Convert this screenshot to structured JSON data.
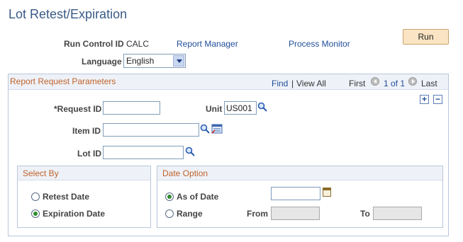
{
  "page": {
    "title": "Lot Retest/Expiration"
  },
  "run_control": {
    "label": "Run Control ID",
    "value": "CALC",
    "report_manager": "Report Manager",
    "process_monitor": "Process Monitor",
    "run_label": "Run"
  },
  "language": {
    "label": "Language",
    "selected": "English"
  },
  "params": {
    "title": "Report Request Parameters",
    "find": "Find",
    "separator": "|",
    "view_all": "View All",
    "first": "First",
    "range_text": "1 of 1",
    "last": "Last",
    "add": "+",
    "remove": "−"
  },
  "fields": {
    "request_id_label": "*Request ID",
    "request_id_value": "",
    "unit_label": "Unit",
    "unit_value": "US001",
    "item_id_label": "Item ID",
    "item_id_value": "",
    "lot_id_label": "Lot ID",
    "lot_id_value": ""
  },
  "select_by": {
    "title": "Select By",
    "options": [
      {
        "label": "Retest Date",
        "selected": false
      },
      {
        "label": "Expiration Date",
        "selected": true
      }
    ]
  },
  "date_option": {
    "title": "Date Option",
    "as_of_label": "As of Date",
    "as_of_selected": true,
    "as_of_value": "",
    "range_label": "Range",
    "range_selected": false,
    "from_label": "From",
    "from_value": "",
    "to_label": "To",
    "to_value": ""
  },
  "colors": {
    "accent": "#c0622a",
    "link": "#1f4d99",
    "title": "#3a5a86",
    "run_button": "#fbe4c3"
  },
  "icons": [
    "search-icon",
    "multi-lookup-icon",
    "calendar-icon",
    "nav-prev-icon",
    "nav-next-icon"
  ]
}
